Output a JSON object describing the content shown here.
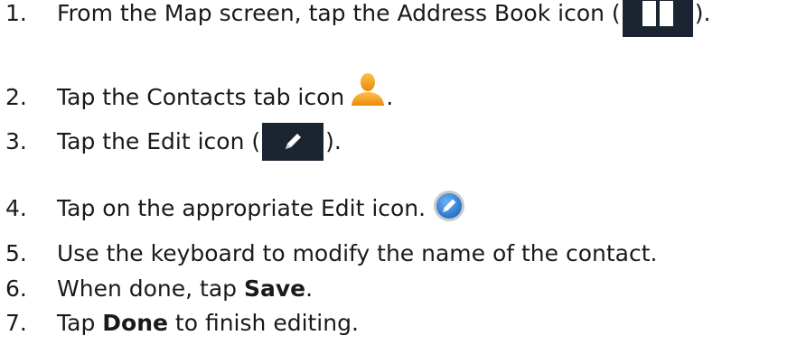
{
  "steps": [
    {
      "number": "1.",
      "before": "From the Map screen, tap the Address Book icon (",
      "after": ")."
    },
    {
      "number": "2.",
      "before": "Tap the Contacts tab icon",
      "after": "."
    },
    {
      "number": "3.",
      "before": "Tap the Edit icon (",
      "after": ")."
    },
    {
      "number": "4.",
      "before": "Tap on the appropriate Edit icon.",
      "after": ""
    },
    {
      "number": "5.",
      "before": "Use the keyboard to modify the name of the contact.",
      "after": ""
    },
    {
      "number": "6.",
      "before": "When done, tap ",
      "bold": "Save",
      "after": "."
    },
    {
      "number": "7.",
      "before": "Tap ",
      "bold": "Done",
      "after": " to finish editing."
    }
  ],
  "icons": {
    "address_book": "book-icon",
    "contacts": "person-icon",
    "edit_dark": "pencil-icon",
    "edit_circle": "circle-pencil-icon"
  },
  "colors": {
    "icon_background": "#1b2532",
    "person_orange": "#f5a623",
    "circle_blue": "#2d7fd6"
  }
}
